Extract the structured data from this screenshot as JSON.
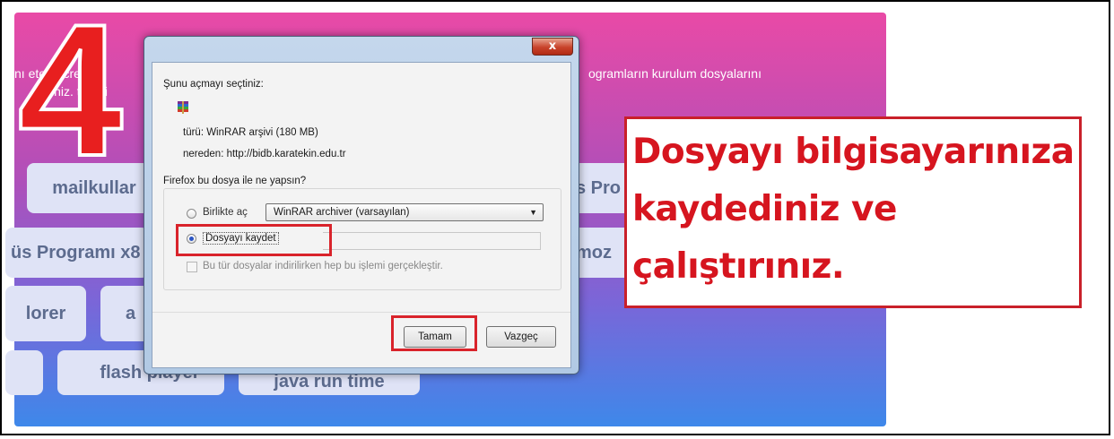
{
  "background_page": {
    "intro_line1_left": "nı eteğ  ücrets",
    "intro_line1_right": "ogramların kurulum dosyalarını",
    "intro_line2_left": "siniz.  teğe i",
    "tiles": {
      "mailkullan": "mailkullar",
      "antivirus_right": "s Pro",
      "antivirus_left": "üs Programı x8",
      "mozilla": "moz",
      "explorer": "lorer",
      "adobe": "a",
      "flash": "flash player",
      "java": "java run time"
    }
  },
  "step_number": "4",
  "dialog": {
    "close_label": "x",
    "heading": "Şunu açmayı seçtiniz:",
    "file_type": "türü:  WinRAR arşivi (180 MB)",
    "file_source": "nereden:  http://bidb.karatekin.edu.tr",
    "question": "Firefox bu dosya ile ne yapsın?",
    "open_with_label": "Birlikte aç",
    "open_with_app": "WinRAR archiver (varsayılan)",
    "save_file_label": "Dosyayı kaydet",
    "remember_label": "Bu tür dosyalar indirilirken hep bu işlemi gerçekleştir.",
    "ok_button": "Tamam",
    "cancel_button": "Vazgeç"
  },
  "instruction": {
    "line1": "Dosyayı bilgisayarınıza",
    "line2": "kaydediniz ve",
    "line3": "çalıştırınız."
  },
  "colors": {
    "annotation_red": "#d9232b",
    "panel_top": "#e94aa6",
    "panel_bottom": "#3e88ea"
  }
}
